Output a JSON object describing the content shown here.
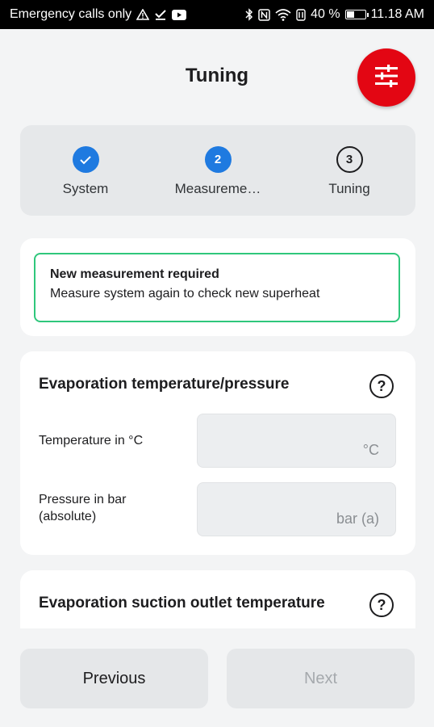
{
  "status_bar": {
    "carrier_text": "Emergency calls only",
    "battery_percent": "40 %",
    "battery_level": 0.4,
    "time": "11.18 AM",
    "icons": [
      "warning-icon",
      "download-done-icon",
      "youtube-icon",
      "bluetooth-icon",
      "nfc-icon",
      "wifi-icon",
      "data-icon",
      "battery-icon"
    ]
  },
  "header": {
    "title": "Tuning",
    "fab_icon": "sliders-icon",
    "accent_color": "#e30613"
  },
  "stepper": {
    "steps": [
      {
        "label": "System",
        "state": "done",
        "number": "1"
      },
      {
        "label": "Measureme…",
        "state": "active",
        "number": "2"
      },
      {
        "label": "Tuning",
        "state": "todo",
        "number": "3"
      }
    ],
    "active_color": "#1f7ae0"
  },
  "notice": {
    "title": "New measurement required",
    "body": "Measure system again to check new superheat",
    "border_color": "#2fc77c"
  },
  "evaporation_section": {
    "title": "Evaporation temperature/pressure",
    "help_icon": "question-icon",
    "temperature": {
      "label": "Temperature in °C",
      "value": "",
      "unit": "°C"
    },
    "pressure": {
      "label": "Pressure in bar\n(absolute)",
      "label_line1": "Pressure in bar",
      "label_line2": "(absolute)",
      "value": "",
      "unit": "bar (a)"
    }
  },
  "suction_section": {
    "title": "Evaporation suction outlet temperature",
    "help_icon": "question-icon"
  },
  "footer": {
    "previous_label": "Previous",
    "next_label": "Next",
    "next_enabled": false
  }
}
